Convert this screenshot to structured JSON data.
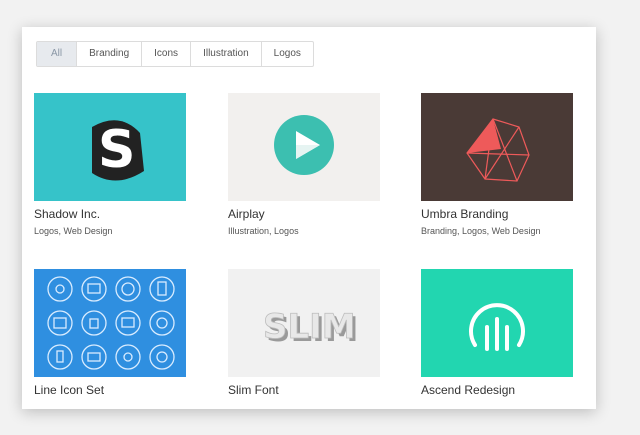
{
  "filters": [
    {
      "label": "All",
      "active": true
    },
    {
      "label": "Branding",
      "active": false
    },
    {
      "label": "Icons",
      "active": false
    },
    {
      "label": "Illustration",
      "active": false
    },
    {
      "label": "Logos",
      "active": false
    }
  ],
  "portfolio": [
    {
      "title": "Shadow Inc.",
      "tags": [
        "Logos",
        "Web Design"
      ],
      "thumb_color": "#36c3c9",
      "logo_letter": "S"
    },
    {
      "title": "Airplay",
      "tags": [
        "Illustration",
        "Logos"
      ],
      "thumb_color": "#f2f0ee",
      "accent": "#3cbfb0"
    },
    {
      "title": "Umbra Branding",
      "tags": [
        "Branding",
        "Logos",
        "Web Design"
      ],
      "thumb_color": "#4a3a36",
      "accent": "#ee5a5a"
    },
    {
      "title": "Line Icon Set",
      "tags": [],
      "thumb_color": "#2f8fe0"
    },
    {
      "title": "Slim Font",
      "tags": [],
      "thumb_color": "#f1f1f1",
      "logo_text": "SLIM"
    },
    {
      "title": "Ascend Redesign",
      "tags": [],
      "thumb_color": "#22d6b0"
    }
  ],
  "icons": {
    "airplay": "play-circle-icon",
    "umbra": "polygon-logo-icon",
    "line_icons": "icon-grid",
    "ascend": "ascend-arc-icon"
  }
}
